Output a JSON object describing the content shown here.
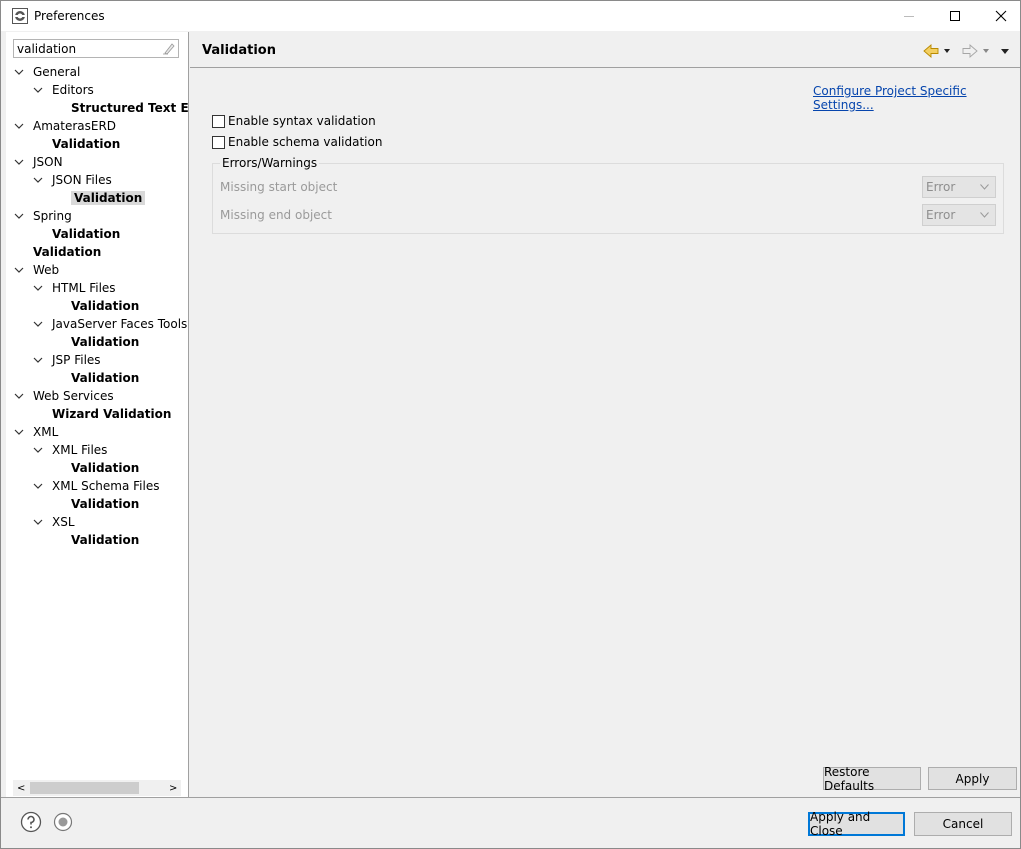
{
  "window": {
    "title": "Preferences",
    "controls": {
      "minimize": "minimize",
      "maximize": "maximize",
      "close": "close"
    }
  },
  "sidebar": {
    "filter": {
      "value": "validation"
    },
    "tree": [
      {
        "label": "General",
        "level": 0,
        "expanded": true,
        "bold": false
      },
      {
        "label": "Editors",
        "level": 1,
        "expanded": true,
        "bold": false
      },
      {
        "label": "Structured Text Ec",
        "level": 2,
        "bold": true
      },
      {
        "label": "AmaterasERD",
        "level": 0,
        "expanded": true,
        "bold": false
      },
      {
        "label": "Validation",
        "level": 1,
        "bold": true
      },
      {
        "label": "JSON",
        "level": 0,
        "expanded": true,
        "bold": false
      },
      {
        "label": "JSON Files",
        "level": 1,
        "expanded": true,
        "bold": false
      },
      {
        "label": "Validation",
        "level": 2,
        "bold": true,
        "selected": true
      },
      {
        "label": "Spring",
        "level": 0,
        "expanded": true,
        "bold": false
      },
      {
        "label": "Validation",
        "level": 1,
        "bold": true
      },
      {
        "label": "Validation",
        "level": 0,
        "bold": true
      },
      {
        "label": "Web",
        "level": 0,
        "expanded": true,
        "bold": false
      },
      {
        "label": "HTML Files",
        "level": 1,
        "expanded": true,
        "bold": false
      },
      {
        "label": "Validation",
        "level": 2,
        "bold": true
      },
      {
        "label": "JavaServer Faces Tools",
        "level": 1,
        "expanded": true,
        "bold": false
      },
      {
        "label": "Validation",
        "level": 2,
        "bold": true
      },
      {
        "label": "JSP Files",
        "level": 1,
        "expanded": true,
        "bold": false
      },
      {
        "label": "Validation",
        "level": 2,
        "bold": true
      },
      {
        "label": "Web Services",
        "level": 0,
        "expanded": true,
        "bold": false
      },
      {
        "label": "Wizard Validation",
        "level": 1,
        "bold": true
      },
      {
        "label": "XML",
        "level": 0,
        "expanded": true,
        "bold": false
      },
      {
        "label": "XML Files",
        "level": 1,
        "expanded": true,
        "bold": false
      },
      {
        "label": "Validation",
        "level": 2,
        "bold": true
      },
      {
        "label": "XML Schema Files",
        "level": 1,
        "expanded": true,
        "bold": false
      },
      {
        "label": "Validation",
        "level": 2,
        "bold": true
      },
      {
        "label": "XSL",
        "level": 1,
        "expanded": true,
        "bold": false
      },
      {
        "label": "Validation",
        "level": 2,
        "bold": true
      }
    ],
    "scroll": {
      "left": "<",
      "right": ">"
    }
  },
  "content": {
    "title": "Validation",
    "config_link": "Configure Project Specific Settings...",
    "checkboxes": [
      {
        "label": "Enable syntax validation",
        "checked": false
      },
      {
        "label": "Enable schema validation",
        "checked": false
      }
    ],
    "group": {
      "label": "Errors/Warnings",
      "rows": [
        {
          "label": "Missing start object",
          "value": "Error"
        },
        {
          "label": "Missing end object",
          "value": "Error"
        }
      ]
    },
    "restore_defaults": "Restore Defaults",
    "apply": "Apply"
  },
  "footer": {
    "apply_close": "Apply and Close",
    "cancel": "Cancel"
  },
  "colors": {
    "link": "#0645ad",
    "default_button_border": "#0078d7",
    "nav_back_arrow": "#e0a800"
  }
}
